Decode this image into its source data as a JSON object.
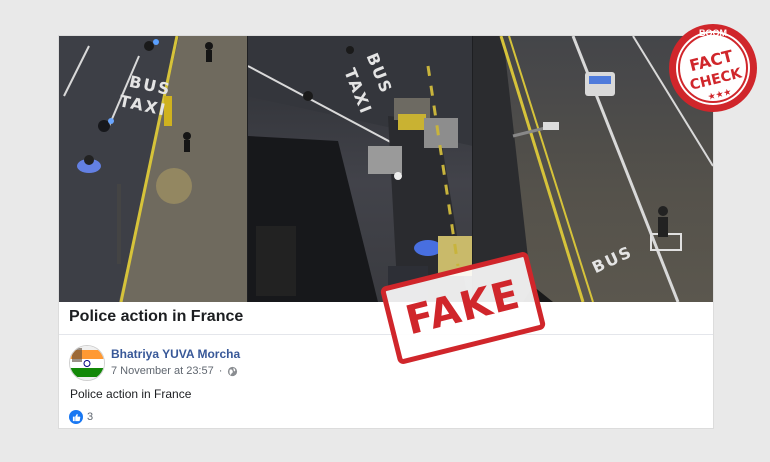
{
  "post": {
    "title": "Police action in France",
    "page_name": "Bhatriya YUVA Morcha",
    "timestamp": "7 November at 23:57",
    "privacy_icon": "globe-icon",
    "body": "Police action in France",
    "reactions": {
      "icon": "like-icon",
      "count": "3"
    }
  },
  "video_frames": {
    "frame1_road_text": [
      "BUS",
      "TAXI"
    ],
    "frame2_road_text": [
      "BUS",
      "TAXI"
    ],
    "frame3_road_text": [
      "BUS"
    ]
  },
  "stamp": {
    "label": "FAKE",
    "color": "#d0262b"
  },
  "badge": {
    "top": "BOOM",
    "line1": "FACT",
    "line2": "CHECK",
    "stars": "★★★",
    "color": "#d0262b"
  }
}
